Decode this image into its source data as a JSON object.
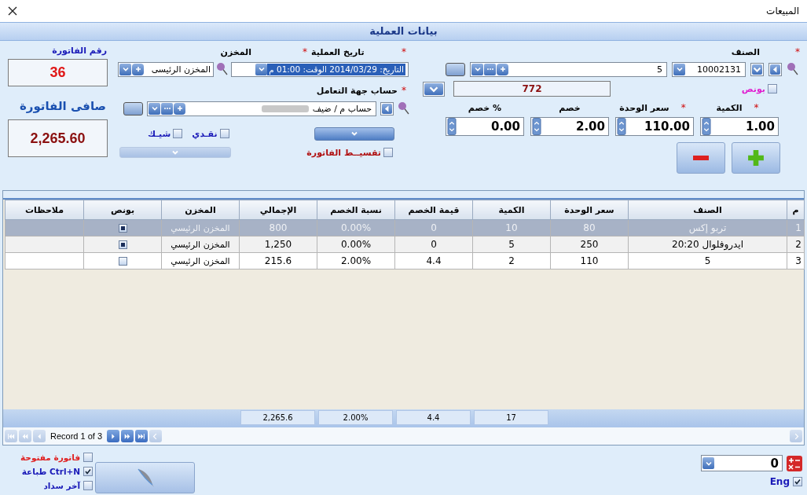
{
  "window": {
    "title": "المبيعات"
  },
  "section_title": "بيانات العملية",
  "invoice": {
    "number_label": "رقم الفاتورة",
    "number": "36",
    "net_label": "صافى الفاتورة",
    "net": "2,265.60"
  },
  "warehouse": {
    "label": "المخزن",
    "required_mark": "*",
    "value": "المخزن الرئيسى"
  },
  "date": {
    "label": "تاريخ العملية",
    "required_mark": "*",
    "value": "التاريخ: 2014/03/29  الوقت: 01:00 م"
  },
  "account": {
    "label": "حساب جهة التعامل",
    "required_mark": "*",
    "value": "حساب م / ضيف"
  },
  "payment": [
    {
      "label": "نقـدي",
      "checked": false
    },
    {
      "label": "شيـك",
      "checked": false
    }
  ],
  "installment": {
    "label": "تقسيــط الفاتورة",
    "checked": false
  },
  "item": {
    "label": "الصنف",
    "required_mark": "*",
    "code": "10002131",
    "name": "5",
    "bonus": {
      "label": "بونص",
      "checked": false
    },
    "stock": "772"
  },
  "entry_fields": [
    {
      "label": "الكمية",
      "required_mark": "*",
      "value": "1.00"
    },
    {
      "label": "سعر الوحدة",
      "required_mark": "*",
      "value": "110.00"
    },
    {
      "label": "خصم",
      "value": "2.00"
    },
    {
      "label": "خصم %",
      "value": "0.00"
    }
  ],
  "table": {
    "columns": [
      "م",
      "الصنف",
      "سعر الوحدة",
      "الكمية",
      "قيمة الخصم",
      "نسبة الخصم",
      "الإجمالي",
      "المخزن",
      "بونص",
      "ملاحظات"
    ],
    "rows": [
      {
        "selected": true,
        "cells": [
          "1",
          "تربو إكس",
          "80",
          "10",
          "0",
          "0.00%",
          "800",
          "المخزن الرئيسي"
        ],
        "bonus": true
      },
      {
        "selected": false,
        "cells": [
          "2",
          "ايدروفلوال 20:20",
          "250",
          "5",
          "0",
          "0.00%",
          "1,250",
          "المخزن الرئيسي"
        ],
        "bonus": true
      },
      {
        "selected": false,
        "cells": [
          "3",
          "5",
          "110",
          "2",
          "4.4",
          "2.00%",
          "215.6",
          "المخزن الرئيسي"
        ],
        "bonus": false
      }
    ],
    "totals": {
      "qty": "17",
      "discount": "4.4",
      "discount_pct": "2.00%",
      "total": "2,265.6"
    }
  },
  "navigator": {
    "text": "Record 1 of 3"
  },
  "footer": {
    "options": [
      {
        "label": "فاتورة مفتوحة",
        "checked": false,
        "color": "#e02020"
      },
      {
        "label": "Ctrl+N طباعة",
        "checked": true,
        "color": "#1a1ab8"
      },
      {
        "label": "آخر سداد",
        "checked": false,
        "color": "#1a1ab8"
      }
    ],
    "calc_value": "0",
    "eng": {
      "label": "Eng",
      "checked": true
    }
  }
}
